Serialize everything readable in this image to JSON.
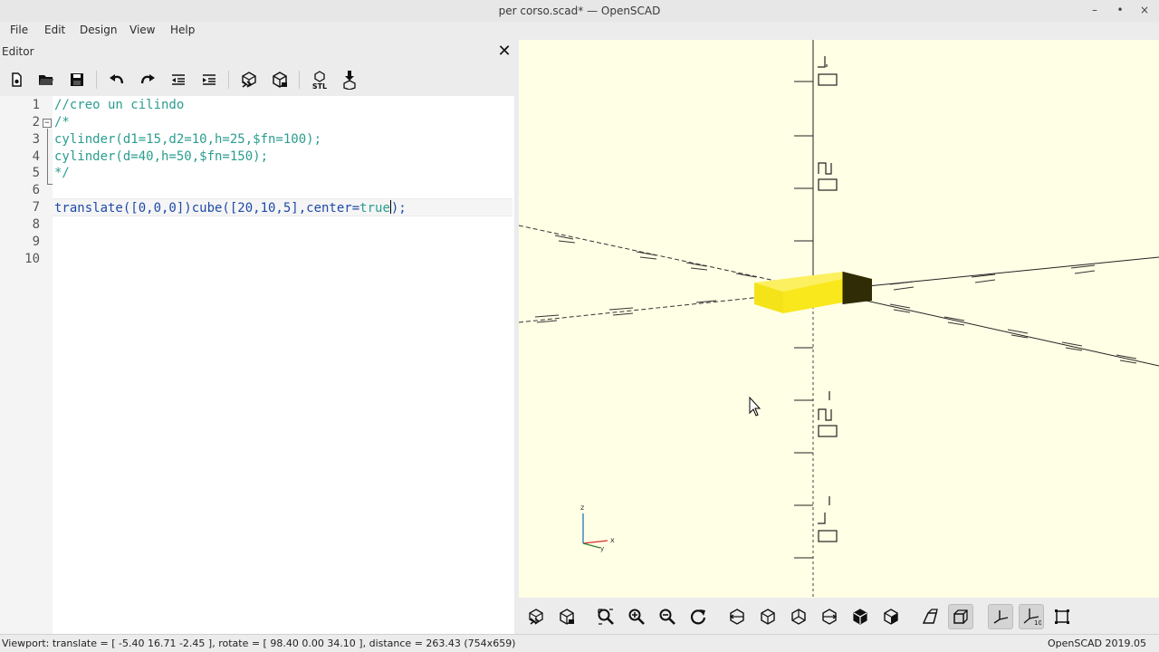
{
  "window": {
    "title": "per corso.scad* — OpenSCAD",
    "controls": [
      "minimize",
      "maximize",
      "close"
    ]
  },
  "menu": {
    "items": [
      "File",
      "Edit",
      "Design",
      "View",
      "Help"
    ]
  },
  "editor": {
    "title": "Editor",
    "close_symbol": "✕",
    "toolbar": [
      "new-file-icon",
      "open-file-icon",
      "save-icon",
      "undo-icon",
      "redo-icon",
      "unindent-icon",
      "indent-icon",
      "preview-icon",
      "render-icon",
      "export-stl-icon",
      "send-to-3d-print-icon"
    ],
    "export_stl_label": "STL",
    "lines": [
      {
        "n": "1",
        "text": "//creo un cilindo",
        "kind": "comment"
      },
      {
        "n": "2",
        "text": "/*",
        "kind": "comment"
      },
      {
        "n": "3",
        "text": "cylinder(d1=15,d2=10,h=25,$fn=100);",
        "kind": "comment"
      },
      {
        "n": "4",
        "text": "cylinder(d=40,h=50,$fn=150);",
        "kind": "comment"
      },
      {
        "n": "5",
        "text": "*/",
        "kind": "comment"
      },
      {
        "n": "6",
        "text": "",
        "kind": "code"
      },
      {
        "n": "7",
        "text": "translate([0,0,0])cube([20,10,5],center=true);",
        "kind": "code"
      },
      {
        "n": "8",
        "text": "",
        "kind": "code"
      },
      {
        "n": "9",
        "text": "",
        "kind": "code"
      },
      {
        "n": "10",
        "text": "",
        "kind": "code"
      }
    ],
    "line7_parts": {
      "a": "translate([0,0,0])cube([20,10,5],center=",
      "b": "true",
      "c": ");"
    }
  },
  "viewport": {
    "background": "#ffffe5",
    "object_color": "#f8e81c",
    "axis_labels": {
      "z": "z",
      "x": "x",
      "y": "y"
    }
  },
  "view_toolbar": [
    "preview-icon",
    "render-icon",
    "view-all-icon",
    "zoom-in-icon",
    "zoom-out-icon",
    "reset-view-icon",
    "view-right-icon",
    "view-top-icon",
    "view-bottom-icon",
    "view-left-icon",
    "view-front-icon",
    "view-back-icon",
    "perspective-icon",
    "orthogonal-icon",
    "show-axes-icon",
    "show-scale-markers-icon",
    "show-edges-icon"
  ],
  "view_toolbar_active": [
    "orthogonal-icon",
    "show-axes-icon",
    "show-scale-markers-icon"
  ],
  "scale_marker_label": "10",
  "status": {
    "viewport": "Viewport: translate = [ -5.40 16.71 -2.45 ], rotate = [ 98.40 0.00 34.10 ], distance = 263.43 (754x659)",
    "version": "OpenSCAD 2019.05"
  }
}
